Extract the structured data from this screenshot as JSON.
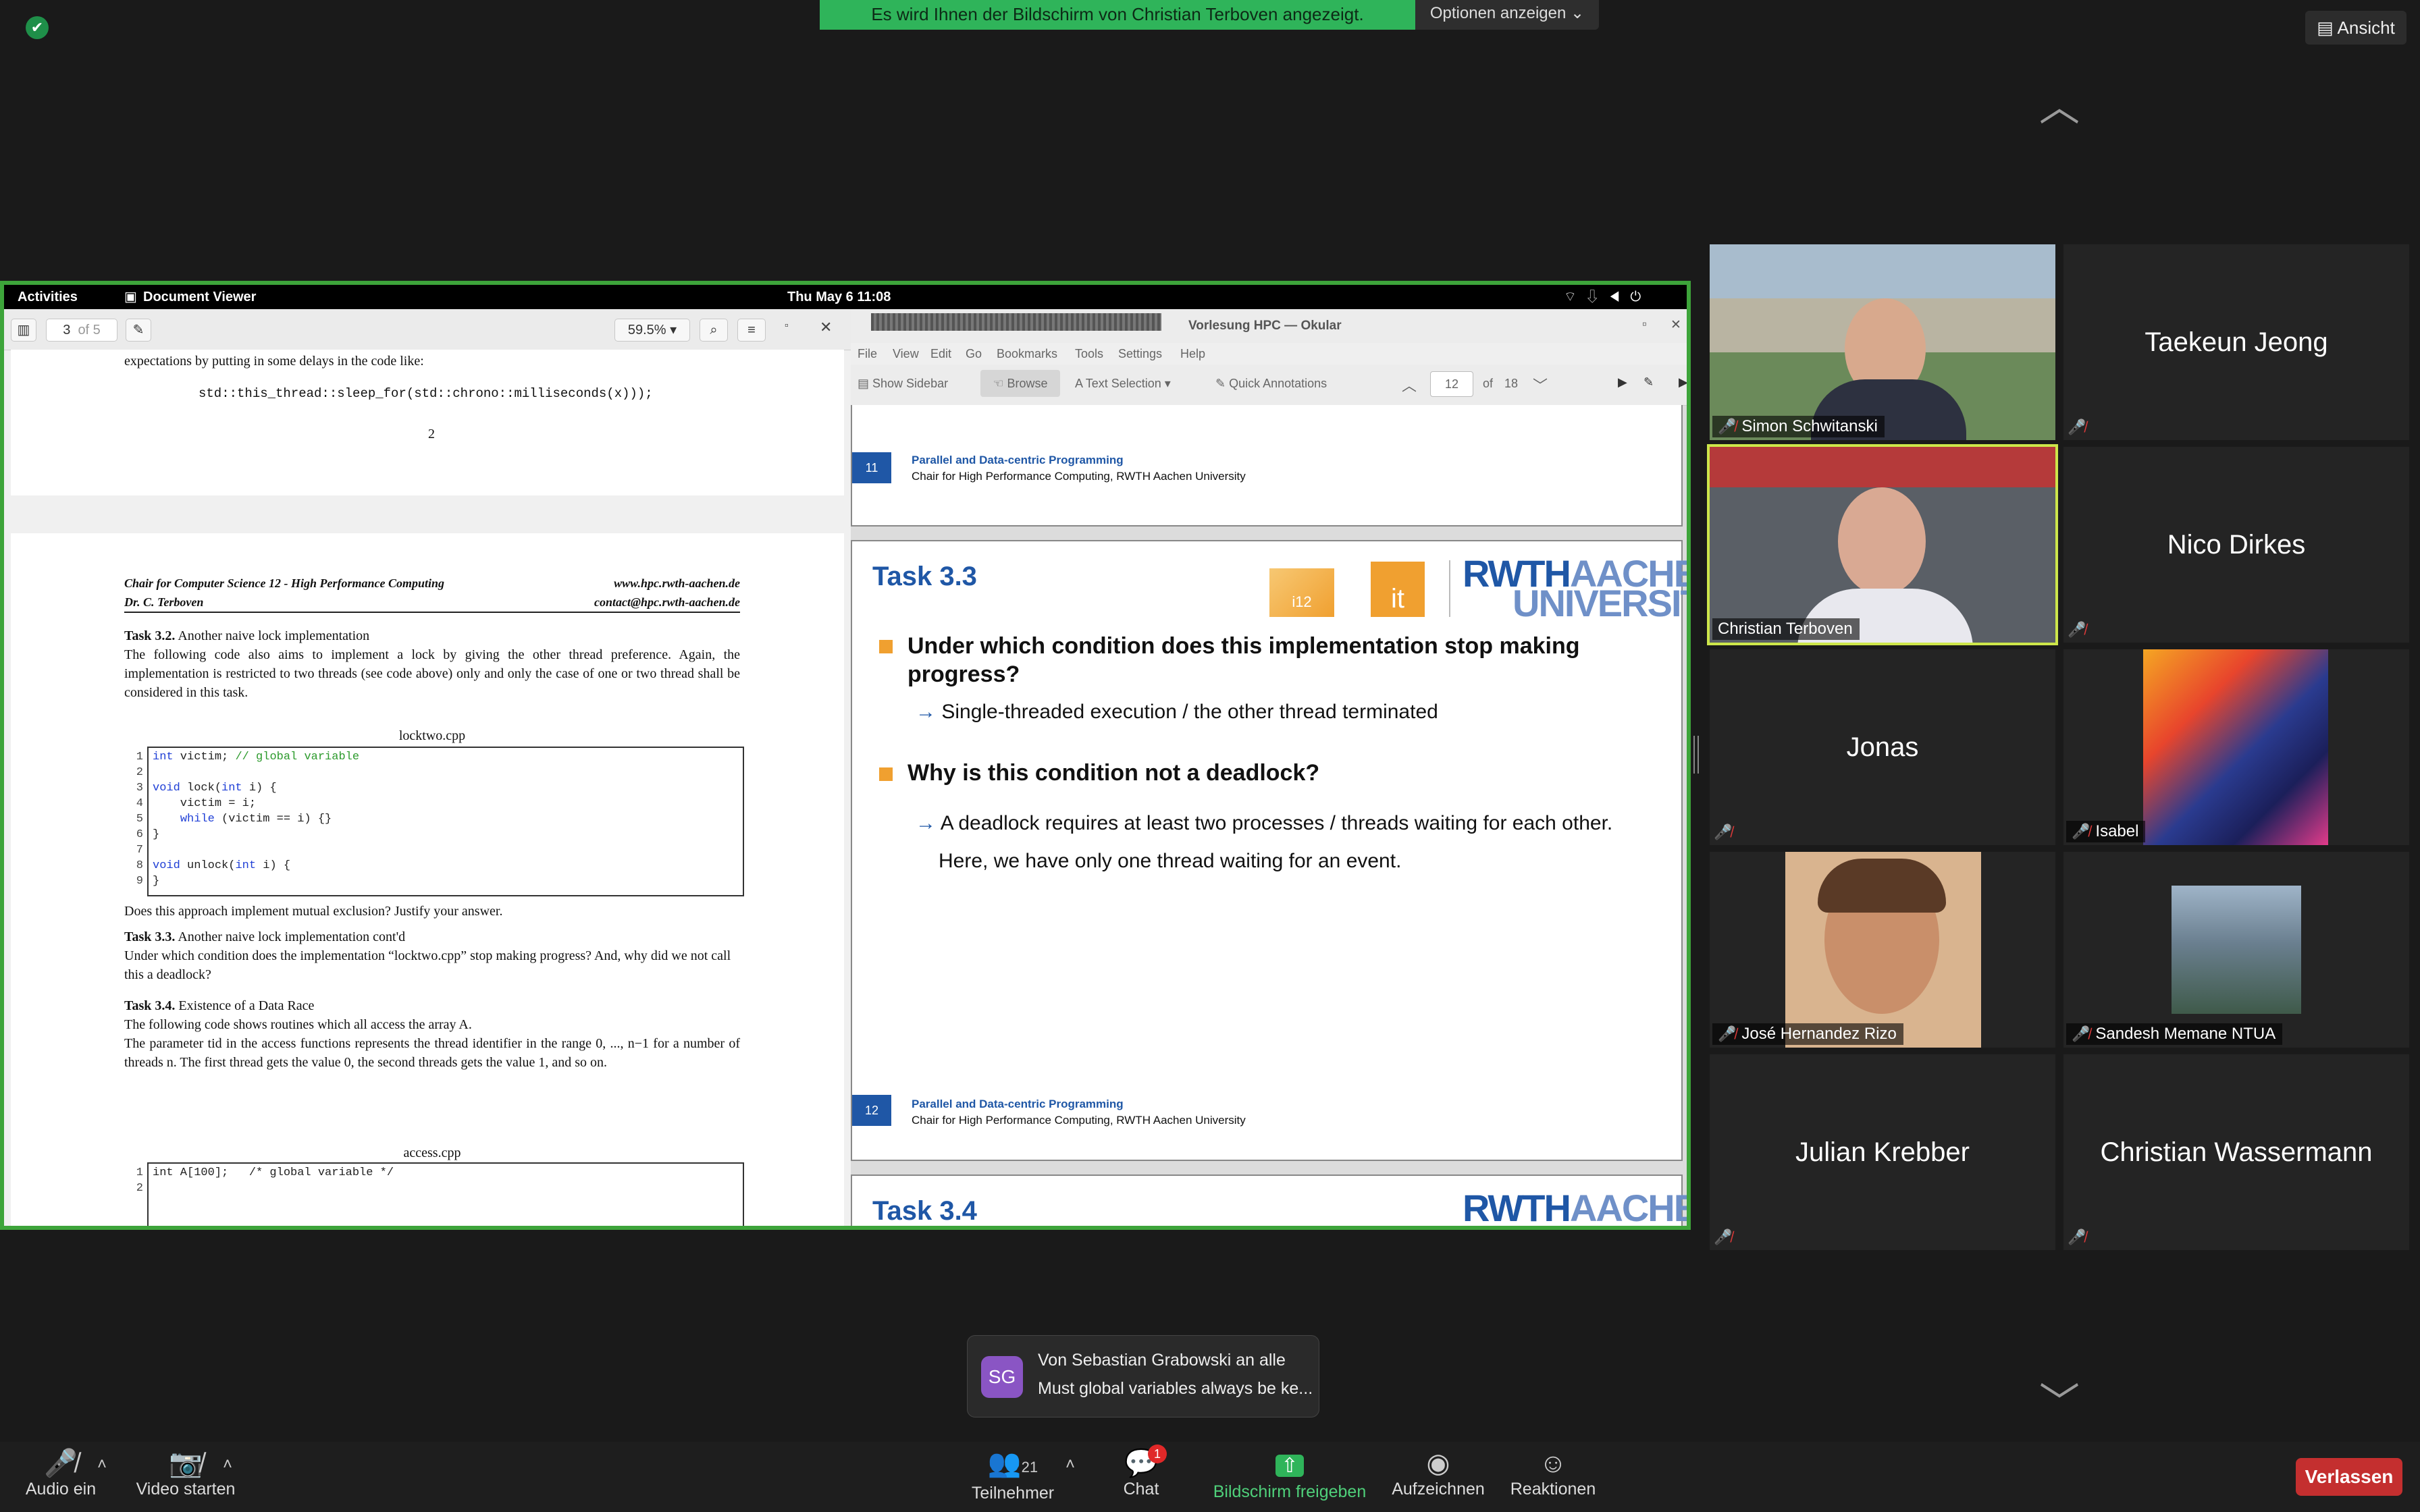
{
  "banner": {
    "text": "Es wird Ihnen der Bildschirm von Christian Terboven angezeigt.",
    "options": "Optionen anzeigen ⌄"
  },
  "ansicht": "Ansicht",
  "gnome": {
    "activities": "Activities",
    "app": "Document Viewer",
    "clock": "Thu May 6 11:08"
  },
  "docviewer": {
    "page_current": "3",
    "page_of": "of 5",
    "zoom": "59.5%",
    "prev_text": "expectations by putting in some delays in the code like:",
    "prev_code": "std::this_thread::sleep_for(std::chrono::milliseconds(x)));",
    "prev_pagenum": "2",
    "header_left1": "Chair for Computer Science 12 - High Performance Computing",
    "header_right1": "www.hpc.rwth-aachen.de",
    "header_left2": "Dr. C. Terboven",
    "header_right2": "contact@hpc.rwth-aachen.de",
    "task32_title": "Task 3.2.",
    "task32_sub": "Another naive lock implementation",
    "task32_body": "The following code also aims to implement a lock by giving the other thread preference. Again, the implementation is restricted to two threads (see code above) only and only the case of one or two thread shall be considered in this task.",
    "code1_title": "locktwo.cpp",
    "code1_lines": [
      "int victim; // global variable",
      "",
      "void lock(int i) {",
      "    victim = i;",
      "    while (victim == i) {}",
      "}",
      "",
      "void unlock(int i) {",
      "}"
    ],
    "question1": "Does this approach implement mutual exclusion? Justify your answer.",
    "task33_title": "Task 3.3.",
    "task33_sub": "Another naive lock implementation cont'd",
    "task33_body": "Under which condition does the implementation “locktwo.cpp” stop making progress? And, why did we not call this a deadlock?",
    "task34_title": "Task 3.4.",
    "task34_sub": "Existence of a Data Race",
    "task34_body1": "The following code shows routines which all access the array A.",
    "task34_body2": "The parameter tid in the access functions represents the thread identifier in the range 0, ..., n−1 for a number of threads n. The first thread gets the value 0, the second threads gets the value 1, and so on.",
    "code2_title": "access.cpp",
    "code2_line1": "int A[100];   /* global variable */"
  },
  "okular": {
    "title": "Vorlesung HPC  — Okular",
    "menu": [
      "File",
      "View",
      "Edit",
      "Go",
      "Bookmarks",
      "Tools",
      "Settings",
      "Help"
    ],
    "tools": {
      "sidebar": "Show Sidebar",
      "browse": "Browse",
      "text_sel": "Text Selection",
      "annot": "Quick Annotations",
      "page": "12",
      "of": "of",
      "total": "18"
    },
    "footer_num_a": "11",
    "footer_num_b": "12",
    "footer_title": "Parallel and Data-centric Programming",
    "footer_sub": "Chair for High Performance Computing, RWTH Aachen University",
    "slide_title": "Task 3.3",
    "q1": "Under which condition does this implementation stop making progress?",
    "a1": "Single-threaded execution / the other thread terminated",
    "q2": "Why is this condition not a deadlock?",
    "a2_1": "A deadlock requires at least two processes / threads waiting for each other.",
    "a2_2": "Here, we have only one thread waiting for an event.",
    "next_title": "Task 3.4",
    "logo_rwth1": "RWTH",
    "logo_rwth2": "AACHEN",
    "logo_rwth3": "UNIVERSITY",
    "logo_i12": "i12",
    "logo_it": "it"
  },
  "participants": [
    {
      "name": "Simon Schwitanski",
      "video": true
    },
    {
      "name": "Taekeun Jeong",
      "video": false
    },
    {
      "name": "Christian Terboven",
      "video": true,
      "speaking": true
    },
    {
      "name": "Nico Dirkes",
      "video": false
    },
    {
      "name": "Jonas",
      "video": false
    },
    {
      "name": "Isabel",
      "video": true
    },
    {
      "name": "José Hernandez Rizo",
      "video": true
    },
    {
      "name": "Sandesh Memane NTUA",
      "video": true
    },
    {
      "name": "Julian Krebber",
      "video": false
    },
    {
      "name": "Christian Wassermann",
      "video": false
    }
  ],
  "chat_popup": {
    "initials": "SG",
    "from": "Von Sebastian Grabowski an alle",
    "message": "Must global variables always be ke..."
  },
  "toolbar": {
    "audio": "Audio ein",
    "video": "Video starten",
    "participants": "Teilnehmer",
    "participants_count": "21",
    "chat": "Chat",
    "chat_badge": "1",
    "share": "Bildschirm freigeben",
    "record": "Aufzeichnen",
    "reactions": "Reaktionen",
    "leave": "Verlassen"
  },
  "colors": {
    "accent_green": "#2fb45a",
    "share_border": "#3da43a",
    "leave_red": "#c42f2f",
    "slide_orange": "#f0a030",
    "rwth_blue": "#1f57a6"
  }
}
